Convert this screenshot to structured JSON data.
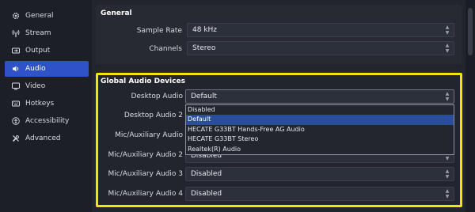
{
  "sidebar": {
    "items": [
      {
        "label": "General",
        "icon": "gear-icon"
      },
      {
        "label": "Stream",
        "icon": "antenna-icon"
      },
      {
        "label": "Output",
        "icon": "output-icon"
      },
      {
        "label": "Audio",
        "icon": "speaker-icon",
        "active": true
      },
      {
        "label": "Video",
        "icon": "monitor-icon"
      },
      {
        "label": "Hotkeys",
        "icon": "keyboard-icon"
      },
      {
        "label": "Accessibility",
        "icon": "accessibility-icon"
      },
      {
        "label": "Advanced",
        "icon": "wrench-icon"
      }
    ]
  },
  "general": {
    "title": "General",
    "sample_rate": {
      "label": "Sample Rate",
      "value": "48 kHz"
    },
    "channels": {
      "label": "Channels",
      "value": "Stereo"
    }
  },
  "global_audio": {
    "title": "Global Audio Devices",
    "desktop_audio": {
      "label": "Desktop Audio",
      "value": "Default"
    },
    "desktop_audio_2": {
      "label": "Desktop Audio 2"
    },
    "mic_audio": {
      "label": "Mic/Auxiliary Audio"
    },
    "mic_audio_2": {
      "label": "Mic/Auxiliary Audio 2",
      "value": "Disabled"
    },
    "mic_audio_3": {
      "label": "Mic/Auxiliary Audio 3",
      "value": "Disabled"
    },
    "mic_audio_4": {
      "label": "Mic/Auxiliary Audio 4",
      "value": "Disabled"
    }
  },
  "dropdown": {
    "options": [
      "Disabled",
      "Default",
      "HECATE G33BT Hands-Free AG Audio",
      "HECATE G33BT Stereo",
      "Realtek(R) Audio"
    ],
    "selected_index": 1
  },
  "colors": {
    "accent": "#2f52c8",
    "highlight_border": "#f2e600",
    "dropdown_selected": "#2a4e9a"
  }
}
